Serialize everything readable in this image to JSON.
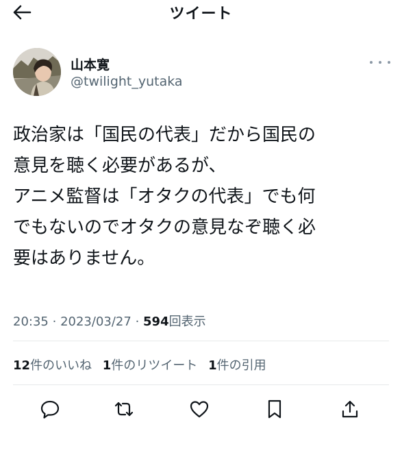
{
  "header": {
    "title": "ツイート"
  },
  "author": {
    "display_name": "山本寛",
    "username": "@twilight_yutaka"
  },
  "tweet": {
    "lines": [
      "政治家は「国民の代表」だから国民の",
      "意見を聴く必要があるが、",
      "アニメ監督は「オタクの代表」でも何",
      "でもないのでオタクの意見なぞ聴く必",
      "要はありません。"
    ],
    "time": "20:35",
    "separator": "·",
    "date": "2023/03/27",
    "views_count": "594",
    "views_label": "回表示"
  },
  "stats": {
    "likes_count": "12",
    "likes_label": "件のいいね",
    "retweets_count": "1",
    "retweets_label": "件のリツイート",
    "quotes_count": "1",
    "quotes_label": "件の引用"
  },
  "colors": {
    "text_primary": "#0f1419",
    "text_secondary": "#536471",
    "divider": "#e6e9ea"
  },
  "icons": {
    "back": "arrow-left-icon",
    "more": "more-horizontal-icon",
    "reply": "reply-icon",
    "retweet": "retweet-icon",
    "like": "heart-icon",
    "bookmark": "bookmark-icon",
    "share": "share-icon"
  }
}
